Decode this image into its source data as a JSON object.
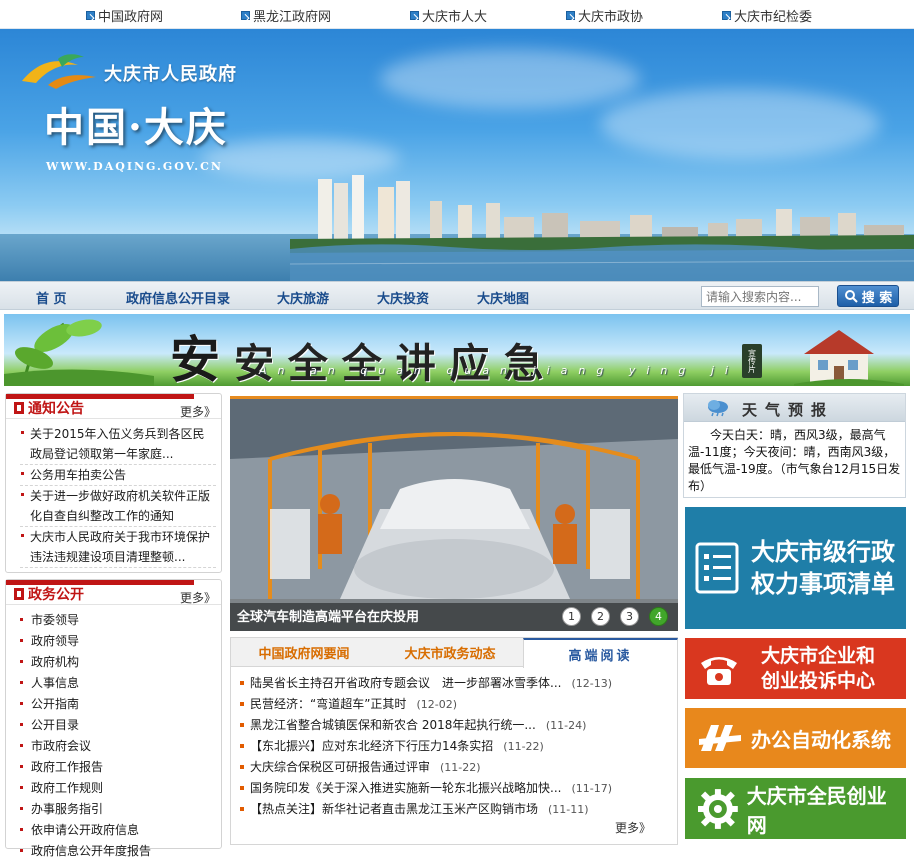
{
  "top_links": [
    "中国政府网",
    "黑龙江政府网",
    "大庆市人大",
    "大庆市政协",
    "大庆市纪检委"
  ],
  "banner": {
    "gov_name": "大庆市人民政府",
    "big_title": "中国·大庆",
    "url": "WWW.DAQING.GOV.CN"
  },
  "nav": {
    "items": [
      "首 页",
      "政府信息公开目录",
      "大庆旅游",
      "大庆投资",
      "大庆地图"
    ],
    "search_placeholder": "请输入搜索内容...",
    "search_button": "搜 索"
  },
  "safety_banner": {
    "first_char": "安",
    "rest": "安 全 全 讲 应 急",
    "pinyin": "An an quan quan jiang ying ji",
    "seal_text": "宣传片"
  },
  "notice": {
    "title": "通知公告",
    "more": "更多》",
    "items": [
      "关于2015年入伍义务兵到各区民政局登记领取第一年家庭...",
      "公务用车拍卖公告",
      "关于进一步做好政府机关软件正版化自查自纠整改工作的通知",
      "大庆市人民政府关于我市环境保护违法违规建设项目清理整顿..."
    ]
  },
  "gov_affairs": {
    "title": "政务公开",
    "more": "更多》",
    "items": [
      "市委领导",
      "政府领导",
      "政府机构",
      "人事信息",
      "公开指南",
      "公开目录",
      "市政府会议",
      "政府工作报告",
      "政府工作规则",
      "办事服务指引",
      "依申请公开政府信息",
      "政府信息公开年度报告"
    ]
  },
  "slideshow": {
    "caption": "全球汽车制造高端平台在庆投用",
    "dots": [
      "1",
      "2",
      "3",
      "4"
    ],
    "active": 3
  },
  "news": {
    "tabs": [
      "中国政府网要闻",
      "大庆市政务动态",
      "高端阅读"
    ],
    "active_tab": 2,
    "items": [
      {
        "title": "陆昊省长主持召开省政府专题会议　进一步部署冰雪季体...",
        "date": "(12-13)"
      },
      {
        "title": "民营经济：“弯道超车”正其时",
        "date": "(12-02)"
      },
      {
        "title": "黑龙江省整合城镇医保和新农合 2018年起执行统一...",
        "date": "(11-24)"
      },
      {
        "title": "【东北振兴】应对东北经济下行压力14条实招",
        "date": "(11-22)"
      },
      {
        "title": "大庆综合保税区可研报告通过评审",
        "date": "(11-22)"
      },
      {
        "title": "国务院印发《关于深入推进实施新一轮东北振兴战略加快...",
        "date": "(11-17)"
      },
      {
        "title": "【热点关注】新华社记者直击黑龙江玉米产区购销市场",
        "date": "(11-11)"
      }
    ],
    "more": "更多》"
  },
  "weather": {
    "title": "天气预报",
    "text": "今天白天：晴，西风3级，最高气温-11度；今天夜间：晴，西南风3级，最低气温-19度。（市气象台12月15日发布）"
  },
  "right_links": [
    {
      "line1": "大庆市级行政",
      "line2": "权力事项清单",
      "color": "#1f7ea8",
      "icon": "list-document-icon"
    },
    {
      "line1": "大庆市企业和",
      "line2": "创业投诉中心",
      "color": "#d9371f",
      "icon": "telephone-icon"
    },
    {
      "line1": "办公自动化系统",
      "line2": "",
      "color": "#e8881c",
      "icon": "oa-logo-icon"
    },
    {
      "line1": "大庆市全民创业网",
      "line2": "",
      "color": "#4a9a2e",
      "icon": "gear-icon"
    }
  ]
}
